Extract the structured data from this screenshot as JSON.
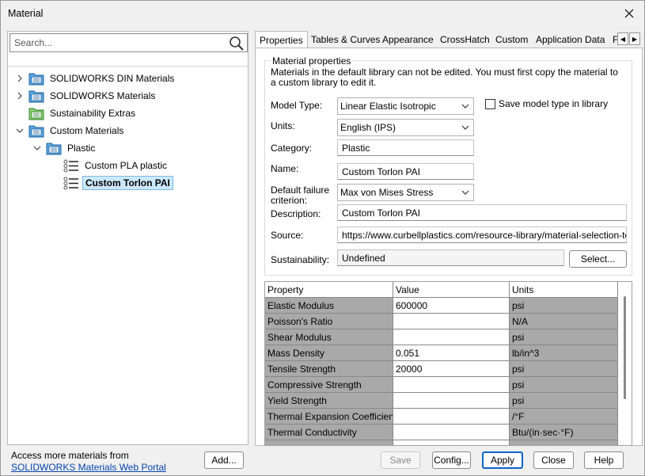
{
  "window": {
    "title": "Material"
  },
  "search": {
    "placeholder": "Search..."
  },
  "tree": [
    {
      "label": "SOLIDWORKS DIN Materials",
      "expand": "collapsed",
      "folder": "db"
    },
    {
      "label": "SOLIDWORKS Materials",
      "expand": "collapsed",
      "folder": "db"
    },
    {
      "label": "Sustainability Extras",
      "expand": "none",
      "folder": "green"
    },
    {
      "label": "Custom Materials",
      "expand": "expanded",
      "folder": "db"
    },
    {
      "label": "Plastic",
      "expand": "expanded",
      "folder": "db"
    },
    {
      "label": "Custom PLA plastic",
      "expand": "none",
      "folder": "list"
    },
    {
      "label": "Custom Torlon PAI",
      "expand": "none",
      "folder": "list",
      "selected": true
    }
  ],
  "footer": {
    "access_text": "Access more materials from",
    "portal_link": "SOLIDWORKS Materials Web Portal",
    "add_label": "Add...",
    "save_label": "Save",
    "config_label": "Config...",
    "apply_label": "Apply",
    "close_label": "Close",
    "help_label": "Help"
  },
  "tabs": [
    "Properties",
    "Tables & Curves",
    "Appearance",
    "CrossHatch",
    "Custom",
    "Application Data",
    "F"
  ],
  "props": {
    "group_title": "Material properties",
    "note": "Materials in the default library can not be edited. You must first copy the material to a custom library to edit it.",
    "model_type_label": "Model Type:",
    "model_type_value": "Linear Elastic Isotropic",
    "save_model_type_label": "Save model type in library",
    "units_label": "Units:",
    "units_value": "English (IPS)",
    "category_label": "Category:",
    "category_value": "Plastic",
    "name_label": "Name:",
    "name_value": "Custom Torlon PAI",
    "failure_label": "Default failure criterion:",
    "failure_value": "Max von Mises Stress",
    "description_label": "Description:",
    "description_value": "Custom Torlon PAI",
    "source_label": "Source:",
    "source_value": "https://www.curbellplastics.com/resource-library/material-selection-to",
    "sustainability_label": "Sustainability:",
    "sustainability_value": "Undefined",
    "select_label": "Select..."
  },
  "table": {
    "headers": [
      "Property",
      "Value",
      "Units"
    ],
    "rows": [
      [
        "Elastic Modulus",
        "600000",
        "psi"
      ],
      [
        "Poisson's Ratio",
        "",
        "N/A"
      ],
      [
        "Shear Modulus",
        "",
        "psi"
      ],
      [
        "Mass Density",
        "0.051",
        "lb/in^3"
      ],
      [
        "Tensile Strength",
        "20000",
        "psi"
      ],
      [
        "Compressive Strength",
        "",
        "psi"
      ],
      [
        "Yield Strength",
        "",
        "psi"
      ],
      [
        "Thermal Expansion Coefficient",
        "",
        "/°F"
      ],
      [
        "Thermal Conductivity",
        "",
        "Btu/(in·sec·°F)"
      ],
      [
        "",
        "",
        ""
      ]
    ]
  }
}
